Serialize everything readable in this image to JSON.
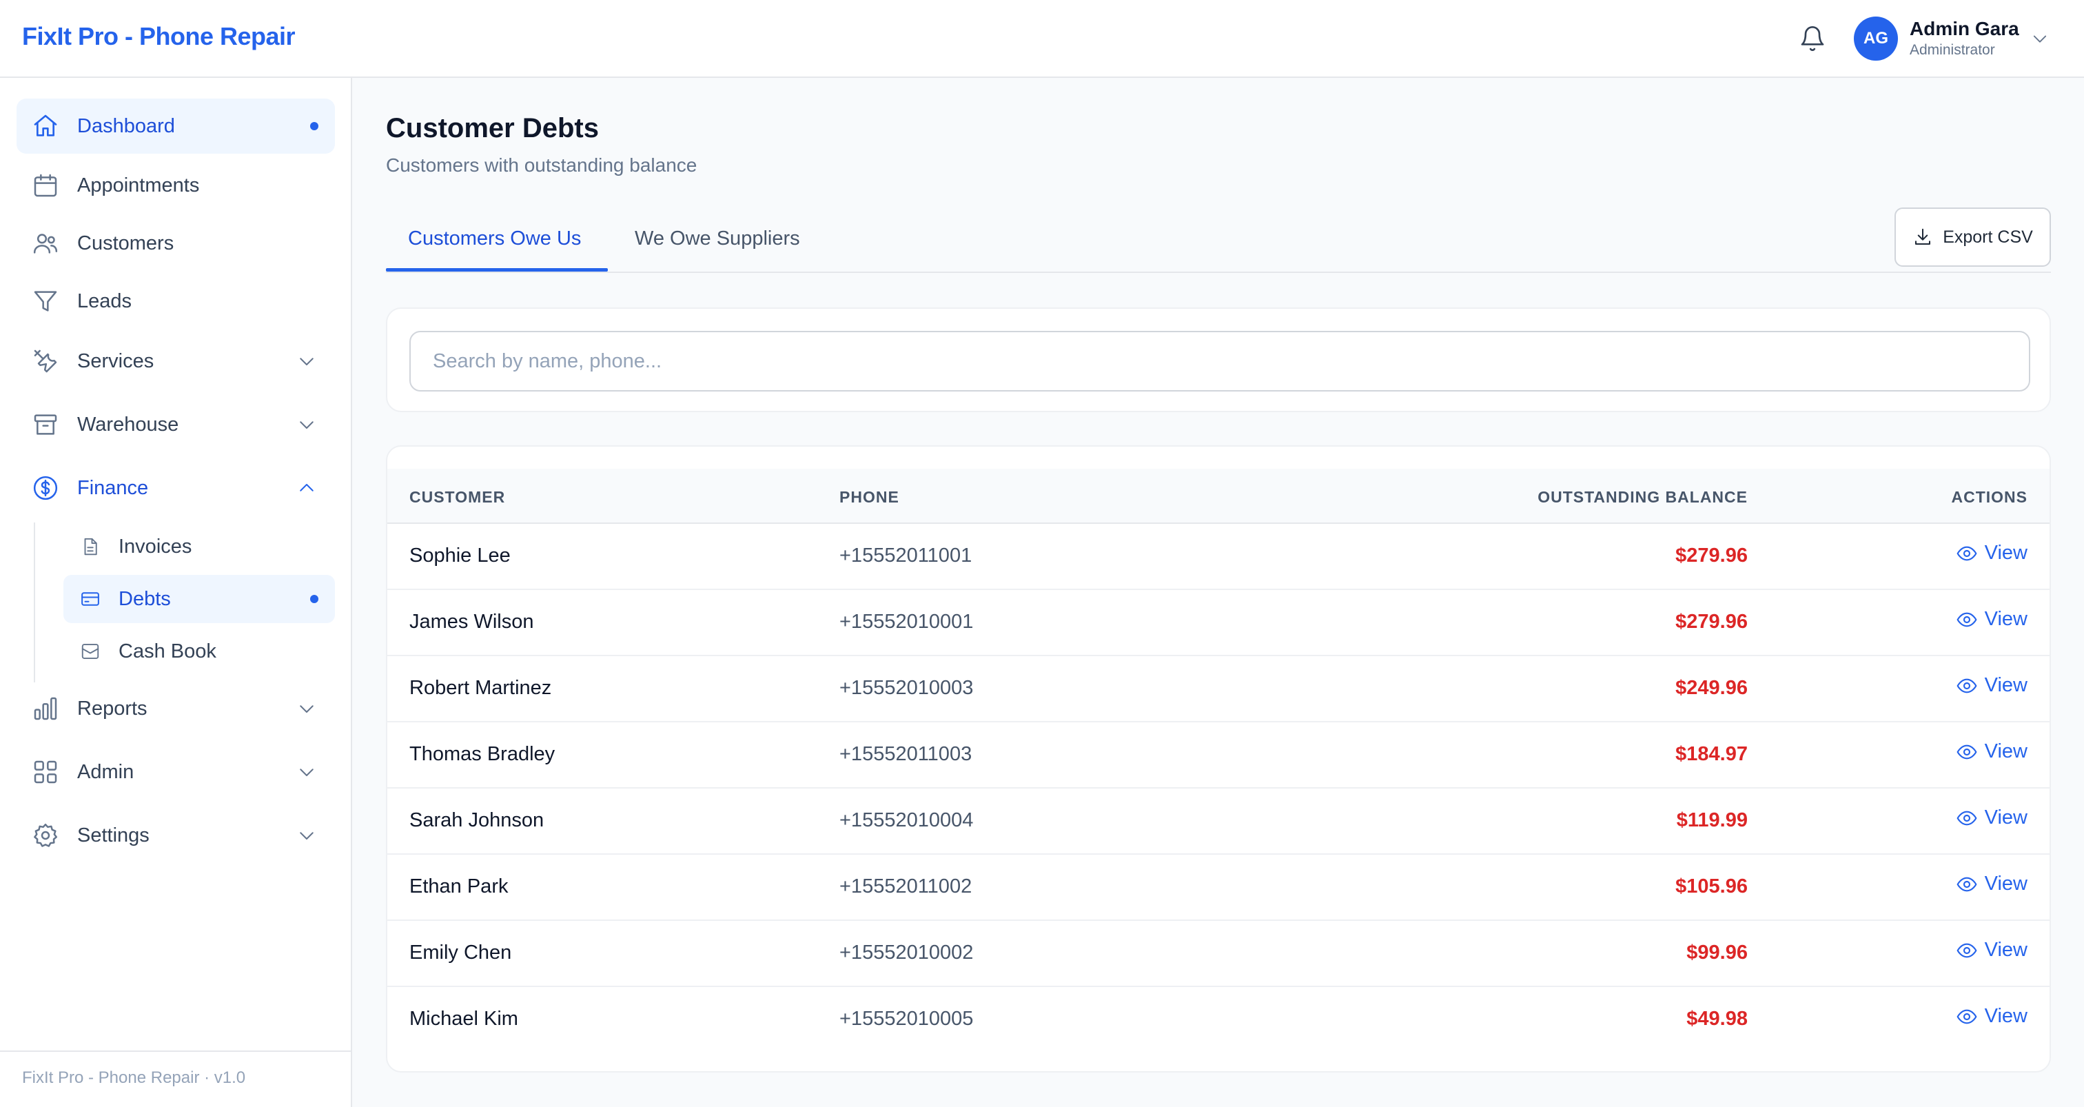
{
  "app": {
    "title": "FixIt Pro - Phone Repair",
    "footer": "FixIt Pro - Phone Repair · v1.0"
  },
  "user": {
    "initials": "AG",
    "name": "Admin Gara",
    "role": "Administrator"
  },
  "sidebar": {
    "items": [
      {
        "label": "Dashboard",
        "icon": "home-icon"
      },
      {
        "label": "Appointments",
        "icon": "calendar-icon"
      },
      {
        "label": "Customers",
        "icon": "users-icon"
      },
      {
        "label": "Leads",
        "icon": "funnel-icon"
      },
      {
        "label": "Services",
        "icon": "tools-icon"
      },
      {
        "label": "Warehouse",
        "icon": "archive-box-icon"
      },
      {
        "label": "Finance",
        "icon": "dollar-circle-icon"
      },
      {
        "label": "Reports",
        "icon": "bar-chart-icon"
      },
      {
        "label": "Admin",
        "icon": "grid-icon"
      },
      {
        "label": "Settings",
        "icon": "gear-icon"
      }
    ],
    "finance_sub": [
      {
        "label": "Invoices",
        "icon": "document-icon"
      },
      {
        "label": "Debts",
        "icon": "credit-card-icon"
      },
      {
        "label": "Cash Book",
        "icon": "inbox-icon"
      }
    ]
  },
  "page": {
    "title": "Customer Debts",
    "subtitle": "Customers with outstanding balance"
  },
  "tabs": [
    {
      "label": "Customers Owe Us"
    },
    {
      "label": "We Owe Suppliers"
    }
  ],
  "toolbar": {
    "export_label": "Export CSV"
  },
  "search": {
    "placeholder": "Search by name, phone...",
    "value": ""
  },
  "table": {
    "headers": [
      "CUSTOMER",
      "PHONE",
      "OUTSTANDING BALANCE",
      "ACTIONS"
    ],
    "action_label": "View",
    "rows": [
      {
        "customer": "Sophie Lee",
        "phone": "+15552011001",
        "balance": "$279.96"
      },
      {
        "customer": "James Wilson",
        "phone": "+15552010001",
        "balance": "$279.96"
      },
      {
        "customer": "Robert Martinez",
        "phone": "+15552010003",
        "balance": "$249.96"
      },
      {
        "customer": "Thomas Bradley",
        "phone": "+15552011003",
        "balance": "$184.97"
      },
      {
        "customer": "Sarah Johnson",
        "phone": "+15552010004",
        "balance": "$119.99"
      },
      {
        "customer": "Ethan Park",
        "phone": "+15552011002",
        "balance": "$105.96"
      },
      {
        "customer": "Emily Chen",
        "phone": "+15552010002",
        "balance": "$99.96"
      },
      {
        "customer": "Michael Kim",
        "phone": "+15552010005",
        "balance": "$49.98"
      }
    ]
  },
  "colors": {
    "accent": "#2563eb",
    "debt": "#dc2626",
    "active_bg": "#eff6ff"
  }
}
